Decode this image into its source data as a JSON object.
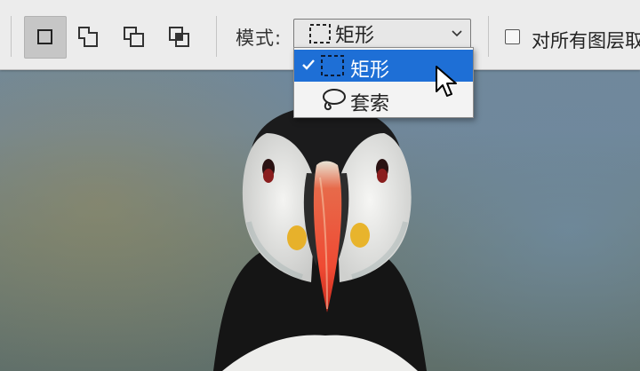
{
  "toolbar": {
    "tools": [
      {
        "name": "new-selection",
        "active": true
      },
      {
        "name": "add-to-selection",
        "active": false
      },
      {
        "name": "subtract-from-selection",
        "active": false
      },
      {
        "name": "intersect-with-selection",
        "active": false
      }
    ],
    "mode_label": "模式:",
    "mode_value": "矩形",
    "sample_all_layers_label": "对所有图层取",
    "sample_all_layers_checked": false
  },
  "mode_dropdown": {
    "options": [
      {
        "label": "矩形",
        "icon": "rectangle-marquee-icon",
        "selected": true
      },
      {
        "label": "套索",
        "icon": "lasso-icon",
        "selected": false
      }
    ]
  },
  "colors": {
    "selection_blue": "#1e6fd6",
    "toolbar_bg": "#ececec"
  }
}
